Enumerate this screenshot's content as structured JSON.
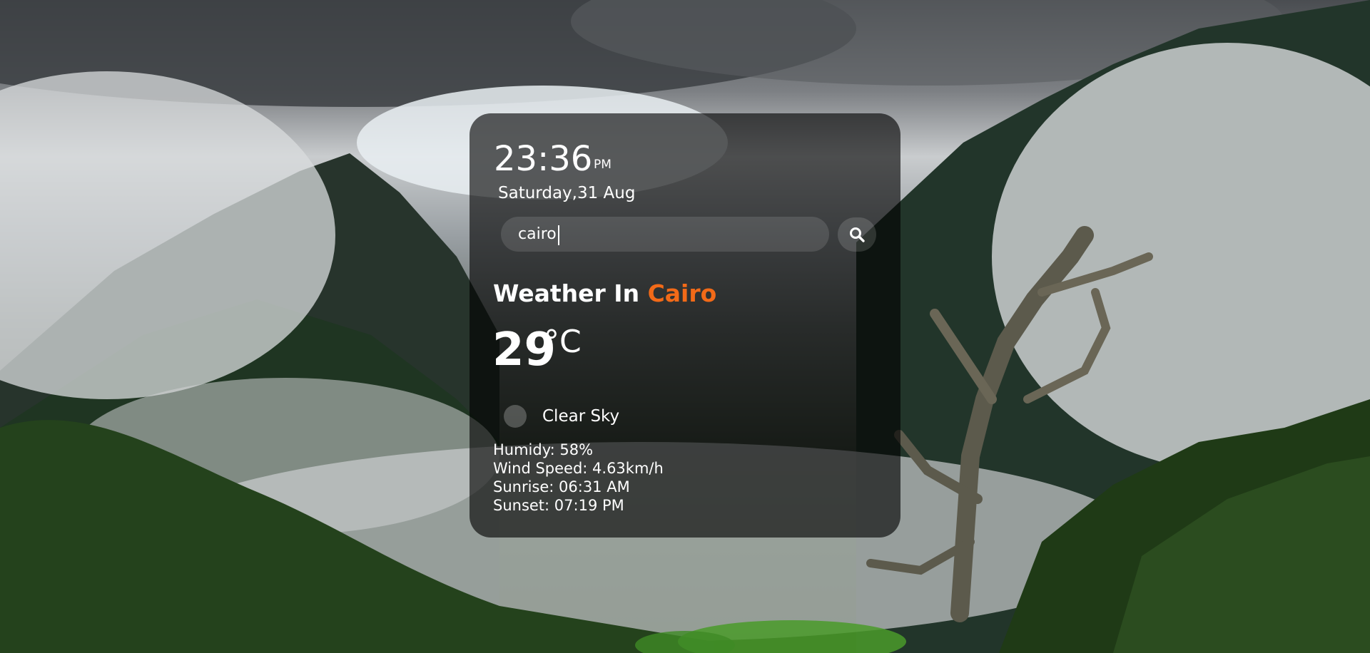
{
  "clock": {
    "time": "23:36",
    "ampm": "PM",
    "date": "Saturday,31 Aug"
  },
  "search": {
    "value": "cairo",
    "button_icon": "search-icon"
  },
  "weather": {
    "heading_prefix": "Weather In",
    "city": "Cairo",
    "temperature": "29",
    "unit": "°C",
    "condition_icon": "clear-sky-icon",
    "condition": "Clear Sky",
    "humidity": "Humidy: 58%",
    "wind": "Wind Speed: 4.63km/h",
    "sunrise": "Sunrise: 06:31 AM",
    "sunset": "Sunset: 07:19 PM"
  },
  "colors": {
    "accent": "#f26a18",
    "card_background": "rgba(0,0,0,0.62)",
    "text": "#ffffff"
  }
}
